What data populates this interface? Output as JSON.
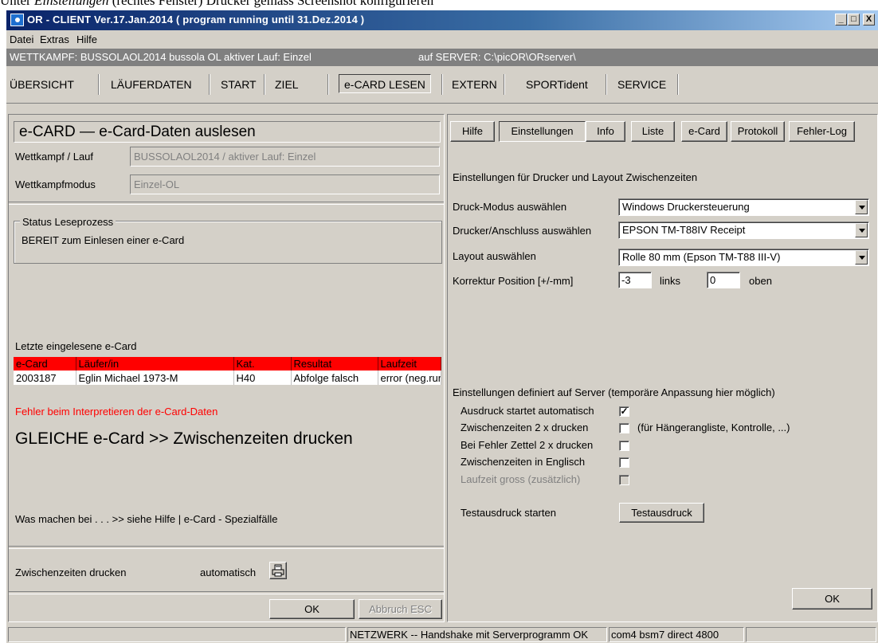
{
  "caption": {
    "prefix": "Unter ",
    "italic": "Einstellungen",
    "suffix": " (rechtes Fenster) Drucker gemäss Screenshot konfigurieren"
  },
  "window": {
    "title": "OR - CLIENT   Ver.17.Jan.2014   ( program running until 31.Dez.2014 )",
    "minimize": "_",
    "maximize": "□",
    "close": "X"
  },
  "menu": [
    "Datei",
    "Extras",
    "Hilfe"
  ],
  "infobar": {
    "wettkampf": "WETTKAMPF:  BUSSOLAOL2014  bussola OL  aktiver Lauf: Einzel",
    "server": "auf  SERVER:  C:\\picOR\\ORserver\\"
  },
  "nav": [
    "ÜBERSICHT",
    "LÄUFERDATEN",
    "START",
    "ZIEL",
    "e-CARD LESEN",
    "EXTERN",
    "SPORTident",
    "SERVICE"
  ],
  "left": {
    "heading": "e-CARD — e-Card-Daten auslesen",
    "wettkampf_label": "Wettkampf / Lauf",
    "wettkampf_value": "BUSSOLAOL2014 / aktiver Lauf: Einzel",
    "modus_label": "Wettkampfmodus",
    "modus_value": "Einzel-OL",
    "status_group": "Status Leseprozess",
    "status_text": "BEREIT zum Einlesen einer e-Card",
    "last_label": "Letzte eingelesene e-Card",
    "table": {
      "headers": [
        "e-Card",
        "Läufer/in",
        "Kat.",
        "Resultat",
        "Laufzeit"
      ],
      "rows": [
        [
          "2003187",
          "Eglin Michael 1973-M",
          "H40",
          "Abfolge falsch",
          "error (neg.run"
        ]
      ]
    },
    "error_text": "Fehler beim Interpretieren der e-Card-Daten",
    "big_text": "GLEICHE e-Card  >> Zwischenzeiten drucken",
    "help_text": "Was machen bei . . .  >> siehe Hilfe | e-Card - Spezialfälle",
    "print_label": "Zwischenzeiten drucken",
    "print_mode": "automatisch",
    "ok": "OK",
    "abbruch": "Abbruch ESC"
  },
  "right": {
    "tabs": [
      "Hilfe",
      "Einstellungen",
      "Info",
      "Liste",
      "e-Card",
      "Protokoll",
      "Fehler-Log"
    ],
    "active_tab": "Einstellungen",
    "section_title": "Einstellungen für Drucker und Layout Zwischenzeiten",
    "druck_label": "Druck-Modus auswählen",
    "druck_value": "Windows Druckersteuerung",
    "drucker_label": "Drucker/Anschluss auswählen",
    "drucker_value": "EPSON TM-T88IV Receipt",
    "layout_label": "Layout auswählen",
    "layout_value": "Rolle 80 mm (Epson TM-T88 III-V)",
    "korr_label": "Korrektur Position [+/-mm]",
    "korr_links": "-3",
    "links_label": "links",
    "korr_oben": "0",
    "oben_label": "oben",
    "server_title": "Einstellungen definiert auf Server (temporäre Anpassung hier möglich)",
    "options": [
      {
        "label": "Ausdruck startet automatisch",
        "checked": true
      },
      {
        "label": "Zwischenzeiten 2 x drucken",
        "checked": false,
        "note": "(für Hängerangliste, Kontrolle, ...)"
      },
      {
        "label": "Bei Fehler Zettel 2 x drucken",
        "checked": false
      },
      {
        "label": "Zwischenzeiten in Englisch",
        "checked": false
      },
      {
        "label": "Laufzeit gross (zusätzlich)",
        "checked": false,
        "disabled": true
      }
    ],
    "test_label": "Testausdruck starten",
    "test_button": "Testausdruck",
    "ok": "OK"
  },
  "status": {
    "network": "NETZWERK -- Handshake mit Serverprogramm OK",
    "port": "com4 bsm7 direct 4800"
  },
  "colors": {
    "table_header": "#ff0000",
    "error_text": "#ff0000",
    "title_start": "#0a246a",
    "title_end": "#a6caf0"
  }
}
